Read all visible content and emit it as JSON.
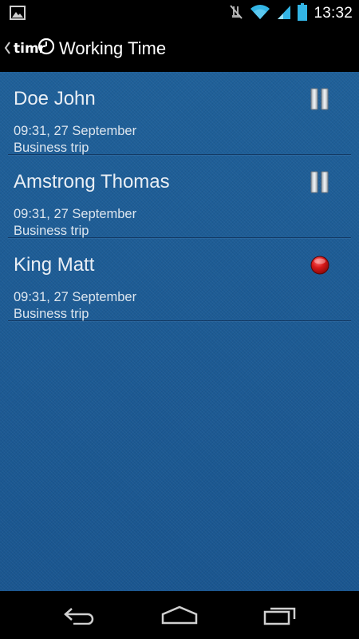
{
  "status_bar": {
    "time": "13:32",
    "icons": [
      "gallery-icon",
      "mute-icon",
      "wifi-icon",
      "signal-icon",
      "battery-icon"
    ]
  },
  "action_bar": {
    "logo_text": "timr",
    "title": "Working Time"
  },
  "entries": [
    {
      "name": "Doe John",
      "time": "09:31, 27 September",
      "type": "Business trip",
      "status": "paused",
      "status_icon": "pause-icon"
    },
    {
      "name": "Amstrong Thomas",
      "time": "09:31, 27 September",
      "type": "Business trip",
      "status": "paused",
      "status_icon": "pause-icon"
    },
    {
      "name": "King Matt",
      "time": "09:31, 27 September",
      "type": "Business trip",
      "status": "recording",
      "status_icon": "record-icon"
    }
  ],
  "nav_bar": {
    "buttons": [
      "back-icon",
      "home-icon",
      "recent-apps-icon"
    ]
  },
  "colors": {
    "background": "#1c5c96",
    "text": "#e9eef4",
    "record": "#d61818",
    "status_accent": "#33b5e5"
  }
}
